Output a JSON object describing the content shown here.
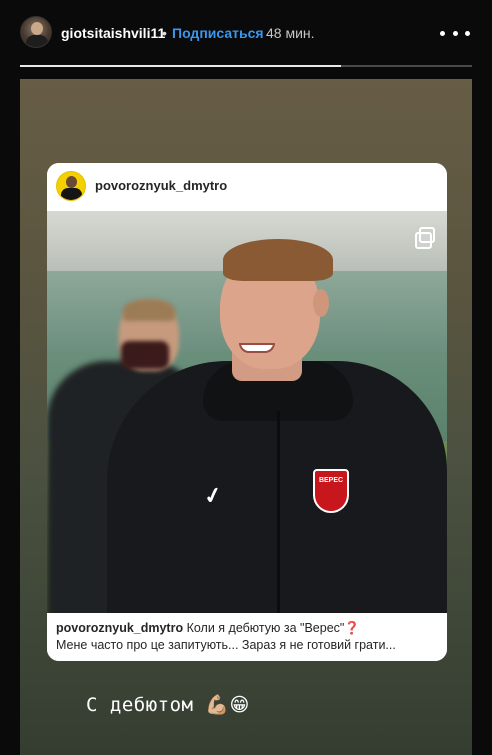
{
  "header": {
    "username": "giotsitaishvili11",
    "separator": "•",
    "subscribe_label": "Подписаться",
    "time_ago": "48 мин.",
    "more_icon": "ellipsis-icon",
    "progress": 0.71
  },
  "post": {
    "username": "povoroznyuk_dmytro",
    "gallery_icon": "carousel-icon",
    "photo": {
      "crest_text": "ВЕРЕС"
    },
    "caption": {
      "username": "povoroznyuk_dmytro",
      "text": " Коли я дебютую за \"Верес\"",
      "emoji": "❓",
      "line2": "Мене часто про це запитують... Зараз я не готовий грати..."
    }
  },
  "story_text": {
    "text": "С дебютом ",
    "emoji": "💪🏼😁"
  },
  "colors": {
    "accent": "#3897f0",
    "story_bg": "#5a553f"
  }
}
